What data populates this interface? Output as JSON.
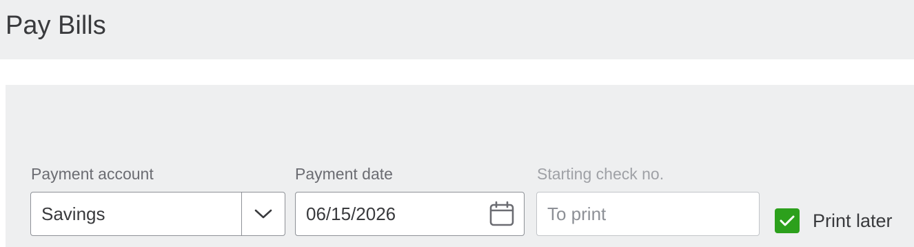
{
  "page": {
    "title": "Pay Bills"
  },
  "form": {
    "payment_account": {
      "label": "Payment account",
      "value": "Savings"
    },
    "payment_date": {
      "label": "Payment date",
      "value": "06/15/2026"
    },
    "starting_check_no": {
      "label": "Starting check no.",
      "placeholder": "To print"
    },
    "print_later": {
      "label": "Print later",
      "checked": true
    }
  },
  "icons": {
    "dropdown": "chevron-down-icon",
    "calendar": "calendar-icon",
    "checkbox": "checkmark-icon"
  },
  "colors": {
    "background_panel": "#eeeff0",
    "text_primary": "#393a3d",
    "text_label": "#6b6c72",
    "checkbox_green": "#2ca01c"
  }
}
